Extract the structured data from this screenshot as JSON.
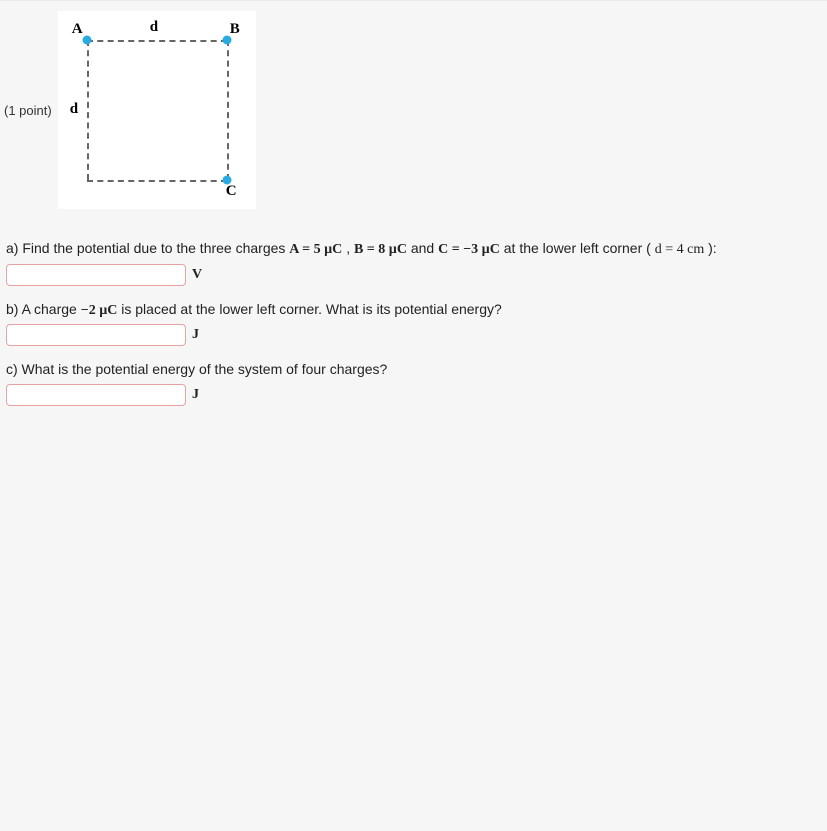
{
  "points_label": "(1 point)",
  "figure": {
    "A": "A",
    "B": "B",
    "C": "C",
    "d_top": "d",
    "d_left": "d"
  },
  "qa": {
    "prefix": "a) Find the potential due to the three charges ",
    "A_eq": "A = 5 µC",
    "sep1": ", ",
    "B_eq": "B = 8 µC",
    "sep2": " and ",
    "C_eq": "C = −3 µC",
    "mid": " at the lower left corner (",
    "d_eq": "d = 4 cm",
    "suffix": "):",
    "unit": "V"
  },
  "qb": {
    "prefix": "b) A charge ",
    "q_eq": "−2 µC",
    "suffix": " is placed at the lower left corner. What is its potential energy?",
    "unit": "J"
  },
  "qc": {
    "text": "c) What is the potential energy of the system of four charges?",
    "unit": "J"
  }
}
